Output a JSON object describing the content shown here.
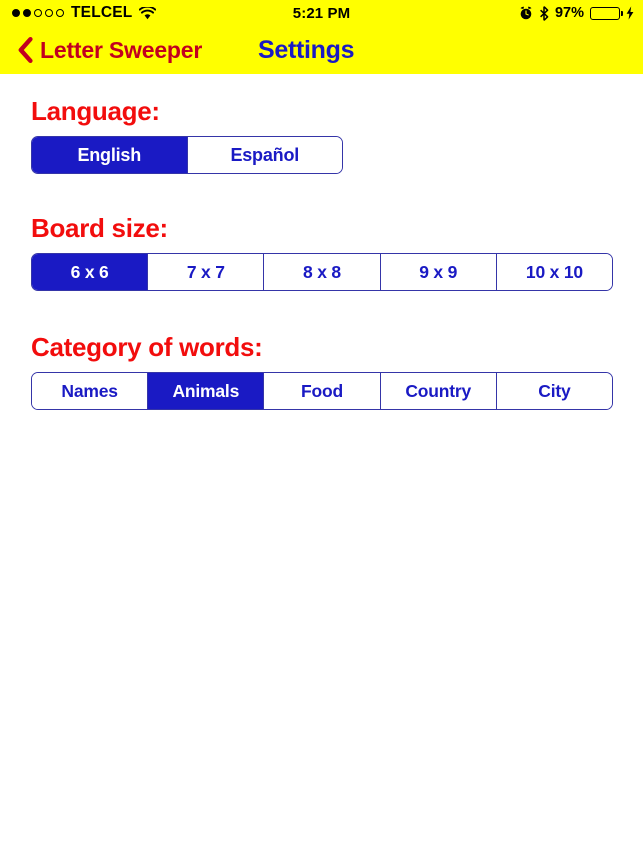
{
  "status_bar": {
    "carrier": "TELCEL",
    "signal_dots_filled": 2,
    "signal_dots_total": 5,
    "wifi_icon": "wifi-icon",
    "time": "5:21 PM",
    "alarm_icon": "alarm-clock-icon",
    "bluetooth_icon": "bluetooth-icon",
    "battery_percent": "97%",
    "battery_level": 97,
    "charging_icon": "lightning-bolt-icon",
    "background_color": "#ffff00",
    "text_color": "#000000",
    "battery_fill_color": "#49dd6b"
  },
  "nav_bar": {
    "back_icon": "chevron-left-icon",
    "back_label": "Letter Sweeper",
    "title": "Settings",
    "background_color": "#ffff00",
    "back_color": "#c2001f",
    "title_color": "#1a1ac4"
  },
  "theme": {
    "heading_color": "#f20d0d",
    "accent_blue": "#1a1ac4",
    "border_blue": "#3535a8",
    "page_background": "#ffffff"
  },
  "sections": [
    {
      "id": "language",
      "title": "Language:",
      "selected": "English",
      "options": [
        {
          "label": "English",
          "selected": true
        },
        {
          "label": "Español",
          "selected": false
        }
      ]
    },
    {
      "id": "board-size",
      "title": "Board size:",
      "selected": "6 x 6",
      "options": [
        {
          "label": "6 x 6",
          "selected": true
        },
        {
          "label": "7 x 7",
          "selected": false
        },
        {
          "label": "8 x 8",
          "selected": false
        },
        {
          "label": "9 x 9",
          "selected": false
        },
        {
          "label": "10 x 10",
          "selected": false
        }
      ]
    },
    {
      "id": "category-of-words",
      "title": "Category of words:",
      "selected": "Animals",
      "options": [
        {
          "label": "Names",
          "selected": false
        },
        {
          "label": "Animals",
          "selected": true
        },
        {
          "label": "Food",
          "selected": false
        },
        {
          "label": "Country",
          "selected": false
        },
        {
          "label": "City",
          "selected": false
        }
      ]
    }
  ]
}
